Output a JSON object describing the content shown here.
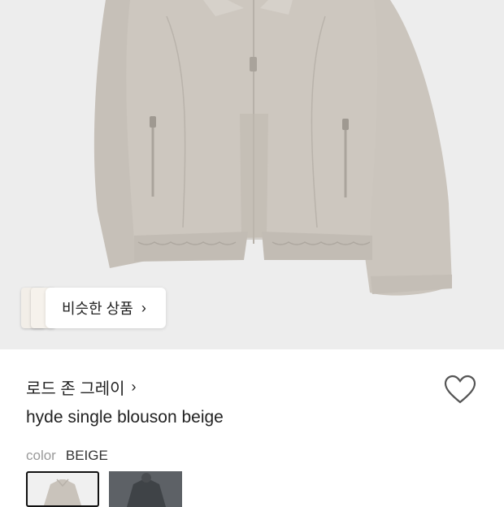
{
  "similar": {
    "label": "비슷한 상품",
    "chevron": "chevron-right-icon"
  },
  "product": {
    "brand": "로드 존 그레이",
    "brand_chevron": "chevron-right-icon",
    "name": "hyde single blouson beige",
    "color_label": "color",
    "color_value": "BEIGE",
    "wishlist_icon": "heart-outline-icon"
  },
  "colors": {
    "hero_bg": "#ededed",
    "jacket": "#c9c3bb",
    "swatch_dark": "#5d6166"
  },
  "swatches": [
    {
      "name": "beige",
      "selected": true
    },
    {
      "name": "charcoal",
      "selected": false
    }
  ]
}
